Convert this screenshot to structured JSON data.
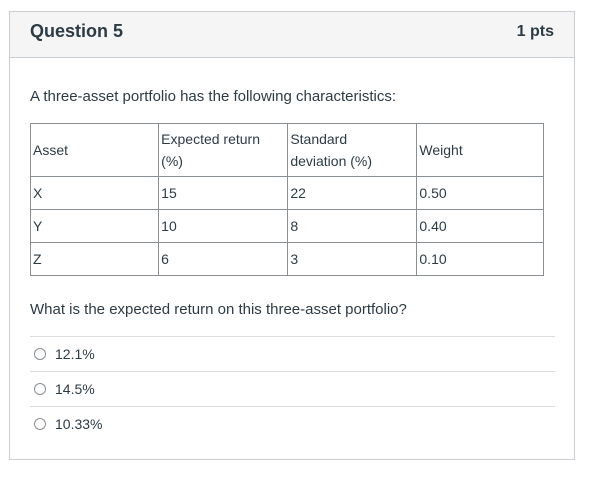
{
  "question": {
    "title": "Question 5",
    "points": "1 pts",
    "intro": "A three-asset portfolio has the following characteristics:",
    "prompt": "What is the expected return on this three-asset portfolio?"
  },
  "table": {
    "headers": {
      "asset": "Asset",
      "expected_return_line1": "Expected return",
      "expected_return_line2": "(%)",
      "std_dev_line1": "Standard",
      "std_dev_line2": "deviation (%)",
      "weight": "Weight"
    },
    "rows": [
      {
        "asset": "X",
        "expected_return": "15",
        "std_dev": "22",
        "weight": "0.50"
      },
      {
        "asset": "Y",
        "expected_return": "10",
        "std_dev": "8",
        "weight": "0.40"
      },
      {
        "asset": "Z",
        "expected_return": "6",
        "std_dev": "3",
        "weight": "0.10"
      }
    ]
  },
  "answers": [
    {
      "label": "12.1%"
    },
    {
      "label": "14.5%"
    },
    {
      "label": "10.33%"
    }
  ]
}
